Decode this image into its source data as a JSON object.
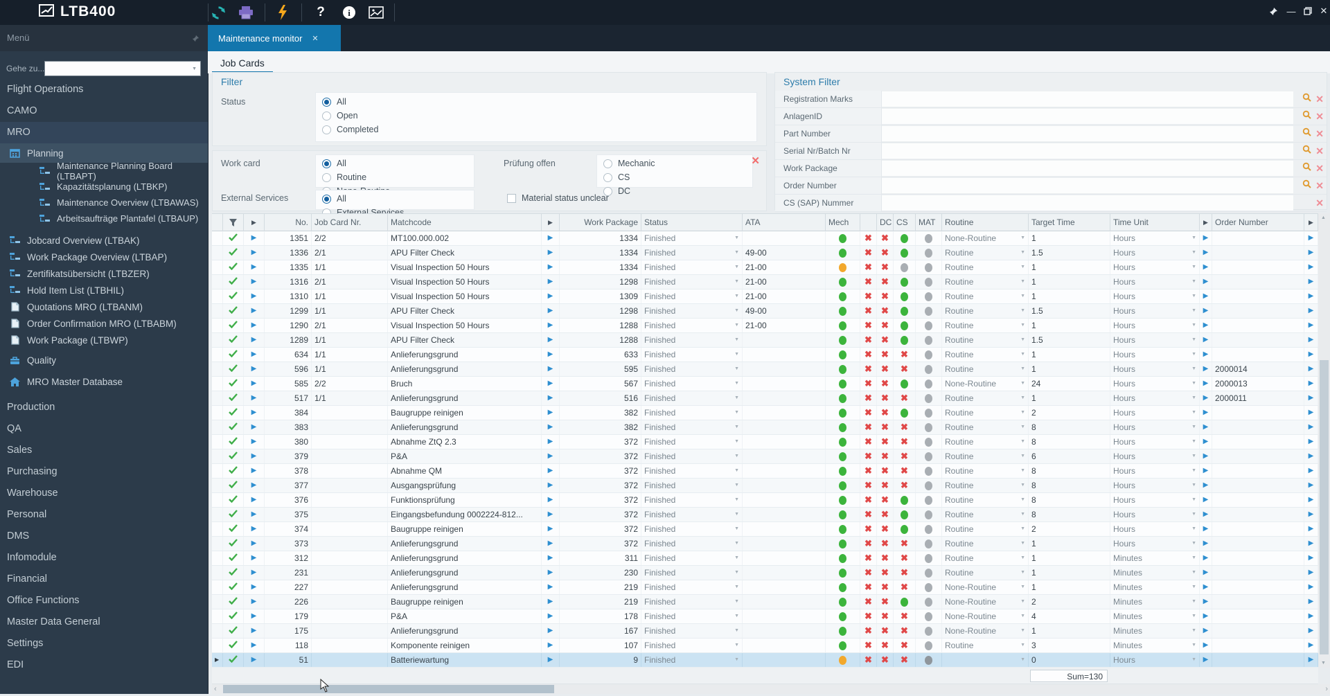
{
  "colors": {
    "accent": "#1376ad",
    "green": "#3cb43c",
    "orange": "#f2a82c",
    "red": "#e04848",
    "play_blue": "#2e8fd0",
    "teal": "#27b3b3",
    "purple": "#7d6bc4",
    "bolt_orange": "#f6a81c"
  },
  "topbar": {
    "logo": "LTB400",
    "icons": [
      "refresh-icon",
      "print-icon",
      "lightning-icon",
      "help-icon",
      "info-icon",
      "image-icon"
    ],
    "window_controls": [
      "pin-icon",
      "minimize-icon",
      "restore-icon",
      "close-icon"
    ]
  },
  "tabbar": {
    "menu_title": "Menü",
    "active_tab": "Maintenance monitor",
    "close_glyph": "✕"
  },
  "sidebar": {
    "goto_label": "Gehe zu...",
    "items": [
      {
        "label": "Flight Operations",
        "type": "section"
      },
      {
        "label": "CAMO",
        "type": "section"
      },
      {
        "label": "MRO",
        "type": "section",
        "state": "active"
      },
      {
        "label": "Planning",
        "icon": "calendar-icon",
        "indent": 1,
        "state": "selected"
      },
      {
        "label": "Maintenance Planning Board (LTBAPT)",
        "icon": "hierarchy-icon",
        "indent": 2
      },
      {
        "label": "Kapazitätsplanung (LTBKP)",
        "icon": "hierarchy-icon",
        "indent": 2
      },
      {
        "label": "Maintenance Overview (LTBAWAS)",
        "icon": "hierarchy-icon",
        "indent": 2
      },
      {
        "label": "Arbeitsaufträge Plantafel (LTBAUP)",
        "icon": "hierarchy-icon",
        "indent": 2
      },
      {
        "label": "Jobcard Overview (LTBAK)",
        "icon": "hierarchy-icon",
        "indent": 1,
        "gap": 8
      },
      {
        "label": "Work Package Overview (LTBAP)",
        "icon": "hierarchy-icon",
        "indent": 1
      },
      {
        "label": "Zertifikatsübersicht (LTBZER)",
        "icon": "hierarchy-icon",
        "indent": 1
      },
      {
        "label": "Hold Item List (LTBHIL)",
        "icon": "hierarchy-icon",
        "indent": 1
      },
      {
        "label": "Quotations MRO (LTBANM)",
        "icon": "document-icon",
        "indent": 1
      },
      {
        "label": "Order Confirmation MRO (LTBABM)",
        "icon": "document-icon",
        "indent": 1
      },
      {
        "label": "Work Package (LTBWP)",
        "icon": "document-icon",
        "indent": 1
      },
      {
        "label": "Quality",
        "icon": "briefcase-icon",
        "indent": 1,
        "gap": 5
      },
      {
        "label": "MRO Master Database",
        "icon": "home-icon",
        "indent": 1,
        "gap": 7
      },
      {
        "label": "Production",
        "type": "section",
        "gap": 10
      },
      {
        "label": "QA",
        "type": "section"
      },
      {
        "label": "Sales",
        "type": "section"
      },
      {
        "label": "Purchasing",
        "type": "section"
      },
      {
        "label": "Warehouse",
        "type": "section"
      },
      {
        "label": "Personal",
        "type": "section"
      },
      {
        "label": "DMS",
        "type": "section"
      },
      {
        "label": "Infomodule",
        "type": "section"
      },
      {
        "label": "Financial",
        "type": "section"
      },
      {
        "label": "Office Functions",
        "type": "section"
      },
      {
        "label": "Master Data General",
        "type": "section"
      },
      {
        "label": "Settings",
        "type": "section"
      },
      {
        "label": "EDI",
        "type": "section"
      }
    ]
  },
  "subtab": "Job Cards",
  "filter": {
    "title": "Filter",
    "status_label": "Status",
    "status_options": [
      "All",
      "Open",
      "Completed"
    ],
    "status_selected": 0,
    "workcard_label": "Work card",
    "workcard_options": [
      "All",
      "Routine",
      "None-Routine"
    ],
    "workcard_selected": 0,
    "extserv_label": "External Services",
    "extserv_options": [
      "All",
      "External Services"
    ],
    "extserv_selected": 0,
    "pruefung_label": "Prüfung offen",
    "pruefung_options": [
      "Mechanic",
      "CS",
      "DC"
    ],
    "pruefung_selected": -1,
    "material_label": "Material status unclear",
    "material_checked": false
  },
  "system_filter": {
    "title": "System Filter",
    "rows": [
      {
        "label": "Registration Marks",
        "has_search": true
      },
      {
        "label": "AnlagenID",
        "has_search": true
      },
      {
        "label": "Part Number",
        "has_search": true
      },
      {
        "label": "Serial Nr/Batch Nr",
        "has_search": true
      },
      {
        "label": "Work Package",
        "has_search": true
      },
      {
        "label": "Order Number",
        "has_search": true
      },
      {
        "label": "CS (SAP) Nummer",
        "has_search": false
      }
    ]
  },
  "table": {
    "headers": {
      "no": "No.",
      "jc": "Job Card Nr.",
      "match": "Matchcode",
      "wp": "Work Package",
      "status": "Status",
      "ata": "ATA",
      "mech": "Mech",
      "x1": "",
      "dc": "DC",
      "cs": "CS",
      "mat": "MAT",
      "routine": "Routine",
      "target": "Target Time",
      "unit": "Time Unit",
      "order": "Order Number"
    },
    "sum_label": "Sum=130",
    "rows": [
      {
        "no": "1351",
        "jc": "2/2",
        "match": "MT100.000.002",
        "wp": "1334",
        "status": "Finished",
        "ata": "",
        "mech": "green",
        "x1": "x",
        "dc": "x",
        "cs": "green",
        "mat": "gray",
        "routine": "None-Routine",
        "target": "1",
        "unit": "Hours",
        "order": "",
        "selected": false
      },
      {
        "no": "1336",
        "jc": "2/1",
        "match": "APU Filter Check",
        "wp": "1334",
        "status": "Finished",
        "ata": "49-00",
        "mech": "green",
        "x1": "x",
        "dc": "x",
        "cs": "green",
        "mat": "gray",
        "routine": "Routine",
        "target": "1.5",
        "unit": "Hours",
        "order": "",
        "selected": false
      },
      {
        "no": "1335",
        "jc": "1/1",
        "match": "Visual Inspection 50 Hours",
        "wp": "1334",
        "status": "Finished",
        "ata": "21-00",
        "mech": "orange",
        "x1": "x",
        "dc": "x",
        "cs": "gray",
        "mat": "gray",
        "routine": "Routine",
        "target": "1",
        "unit": "Hours",
        "order": "",
        "selected": false
      },
      {
        "no": "1316",
        "jc": "2/1",
        "match": "Visual Inspection 50 Hours",
        "wp": "1298",
        "status": "Finished",
        "ata": "21-00",
        "mech": "green",
        "x1": "x",
        "dc": "x",
        "cs": "green",
        "mat": "gray",
        "routine": "Routine",
        "target": "1",
        "unit": "Hours",
        "order": "",
        "selected": false
      },
      {
        "no": "1310",
        "jc": "1/1",
        "match": "Visual Inspection 50 Hours",
        "wp": "1309",
        "status": "Finished",
        "ata": "21-00",
        "mech": "green",
        "x1": "x",
        "dc": "x",
        "cs": "green",
        "mat": "gray",
        "routine": "Routine",
        "target": "1",
        "unit": "Hours",
        "order": "",
        "selected": false
      },
      {
        "no": "1299",
        "jc": "1/1",
        "match": "APU Filter Check",
        "wp": "1298",
        "status": "Finished",
        "ata": "49-00",
        "mech": "green",
        "x1": "x",
        "dc": "x",
        "cs": "green",
        "mat": "gray",
        "routine": "Routine",
        "target": "1.5",
        "unit": "Hours",
        "order": "",
        "selected": false
      },
      {
        "no": "1290",
        "jc": "2/1",
        "match": "Visual Inspection 50 Hours",
        "wp": "1288",
        "status": "Finished",
        "ata": "21-00",
        "mech": "green",
        "x1": "x",
        "dc": "x",
        "cs": "green",
        "mat": "gray",
        "routine": "Routine",
        "target": "1",
        "unit": "Hours",
        "order": "",
        "selected": false
      },
      {
        "no": "1289",
        "jc": "1/1",
        "match": "APU Filter Check",
        "wp": "1288",
        "status": "Finished",
        "ata": "",
        "mech": "green",
        "x1": "x",
        "dc": "x",
        "cs": "green",
        "mat": "gray",
        "routine": "Routine",
        "target": "1.5",
        "unit": "Hours",
        "order": "",
        "selected": false
      },
      {
        "no": "634",
        "jc": "1/1",
        "match": "Anlieferungsgrund",
        "wp": "633",
        "status": "Finished",
        "ata": "",
        "mech": "green",
        "x1": "x",
        "dc": "x",
        "cs": "x",
        "mat": "gray",
        "routine": "Routine",
        "target": "1",
        "unit": "Hours",
        "order": "",
        "selected": false
      },
      {
        "no": "596",
        "jc": "1/1",
        "match": "Anlieferungsgrund",
        "wp": "595",
        "status": "Finished",
        "ata": "",
        "mech": "green",
        "x1": "x",
        "dc": "x",
        "cs": "x",
        "mat": "gray",
        "routine": "Routine",
        "target": "1",
        "unit": "Hours",
        "order": "2000014",
        "selected": false
      },
      {
        "no": "585",
        "jc": "2/2",
        "match": "Bruch",
        "wp": "567",
        "status": "Finished",
        "ata": "",
        "mech": "green",
        "x1": "x",
        "dc": "x",
        "cs": "green",
        "mat": "gray",
        "routine": "None-Routine",
        "target": "24",
        "unit": "Hours",
        "order": "2000013",
        "selected": false
      },
      {
        "no": "517",
        "jc": "1/1",
        "match": "Anlieferungsgrund",
        "wp": "516",
        "status": "Finished",
        "ata": "",
        "mech": "green",
        "x1": "x",
        "dc": "x",
        "cs": "x",
        "mat": "gray",
        "routine": "Routine",
        "target": "1",
        "unit": "Hours",
        "order": "2000011",
        "selected": false
      },
      {
        "no": "384",
        "jc": "",
        "match": "Baugruppe reinigen",
        "wp": "382",
        "status": "Finished",
        "ata": "",
        "mech": "green",
        "x1": "x",
        "dc": "x",
        "cs": "green",
        "mat": "gray",
        "routine": "Routine",
        "target": "2",
        "unit": "Hours",
        "order": "",
        "selected": false
      },
      {
        "no": "383",
        "jc": "",
        "match": "Anlieferungsgrund",
        "wp": "382",
        "status": "Finished",
        "ata": "",
        "mech": "green",
        "x1": "x",
        "dc": "x",
        "cs": "x",
        "mat": "gray",
        "routine": "Routine",
        "target": "8",
        "unit": "Hours",
        "order": "",
        "selected": false
      },
      {
        "no": "380",
        "jc": "",
        "match": "Abnahme ZtQ 2.3",
        "wp": "372",
        "status": "Finished",
        "ata": "",
        "mech": "green",
        "x1": "x",
        "dc": "x",
        "cs": "x",
        "mat": "gray",
        "routine": "Routine",
        "target": "8",
        "unit": "Hours",
        "order": "",
        "selected": false
      },
      {
        "no": "379",
        "jc": "",
        "match": "P&A",
        "wp": "372",
        "status": "Finished",
        "ata": "",
        "mech": "green",
        "x1": "x",
        "dc": "x",
        "cs": "x",
        "mat": "gray",
        "routine": "Routine",
        "target": "6",
        "unit": "Hours",
        "order": "",
        "selected": false
      },
      {
        "no": "378",
        "jc": "",
        "match": "Abnahme QM",
        "wp": "372",
        "status": "Finished",
        "ata": "",
        "mech": "green",
        "x1": "x",
        "dc": "x",
        "cs": "x",
        "mat": "gray",
        "routine": "Routine",
        "target": "8",
        "unit": "Hours",
        "order": "",
        "selected": false
      },
      {
        "no": "377",
        "jc": "",
        "match": "Ausgangsprüfung",
        "wp": "372",
        "status": "Finished",
        "ata": "",
        "mech": "green",
        "x1": "x",
        "dc": "x",
        "cs": "x",
        "mat": "gray",
        "routine": "Routine",
        "target": "8",
        "unit": "Hours",
        "order": "",
        "selected": false
      },
      {
        "no": "376",
        "jc": "",
        "match": "Funktionsprüfung",
        "wp": "372",
        "status": "Finished",
        "ata": "",
        "mech": "green",
        "x1": "x",
        "dc": "x",
        "cs": "green",
        "mat": "gray",
        "routine": "Routine",
        "target": "8",
        "unit": "Hours",
        "order": "",
        "selected": false
      },
      {
        "no": "375",
        "jc": "",
        "match": "Eingangsbefundung 0002224-812...",
        "wp": "372",
        "status": "Finished",
        "ata": "",
        "mech": "green",
        "x1": "x",
        "dc": "x",
        "cs": "green",
        "mat": "gray",
        "routine": "Routine",
        "target": "8",
        "unit": "Hours",
        "order": "",
        "selected": false
      },
      {
        "no": "374",
        "jc": "",
        "match": "Baugruppe reinigen",
        "wp": "372",
        "status": "Finished",
        "ata": "",
        "mech": "green",
        "x1": "x",
        "dc": "x",
        "cs": "green",
        "mat": "gray",
        "routine": "Routine",
        "target": "2",
        "unit": "Hours",
        "order": "",
        "selected": false
      },
      {
        "no": "373",
        "jc": "",
        "match": "Anlieferungsgrund",
        "wp": "372",
        "status": "Finished",
        "ata": "",
        "mech": "green",
        "x1": "x",
        "dc": "x",
        "cs": "x",
        "mat": "gray",
        "routine": "Routine",
        "target": "1",
        "unit": "Hours",
        "order": "",
        "selected": false
      },
      {
        "no": "312",
        "jc": "",
        "match": "Anlieferungsgrund",
        "wp": "311",
        "status": "Finished",
        "ata": "",
        "mech": "green",
        "x1": "x",
        "dc": "x",
        "cs": "x",
        "mat": "gray",
        "routine": "Routine",
        "target": "1",
        "unit": "Minutes",
        "order": "",
        "selected": false
      },
      {
        "no": "231",
        "jc": "",
        "match": "Anlieferungsgrund",
        "wp": "230",
        "status": "Finished",
        "ata": "",
        "mech": "green",
        "x1": "x",
        "dc": "x",
        "cs": "x",
        "mat": "gray",
        "routine": "Routine",
        "target": "1",
        "unit": "Minutes",
        "order": "",
        "selected": false
      },
      {
        "no": "227",
        "jc": "",
        "match": "Anlieferungsgrund",
        "wp": "219",
        "status": "Finished",
        "ata": "",
        "mech": "green",
        "x1": "x",
        "dc": "x",
        "cs": "x",
        "mat": "gray",
        "routine": "None-Routine",
        "target": "1",
        "unit": "Minutes",
        "order": "",
        "selected": false
      },
      {
        "no": "226",
        "jc": "",
        "match": "Baugruppe reinigen",
        "wp": "219",
        "status": "Finished",
        "ata": "",
        "mech": "green",
        "x1": "x",
        "dc": "x",
        "cs": "green",
        "mat": "gray",
        "routine": "None-Routine",
        "target": "2",
        "unit": "Minutes",
        "order": "",
        "selected": false
      },
      {
        "no": "179",
        "jc": "",
        "match": "P&A",
        "wp": "178",
        "status": "Finished",
        "ata": "",
        "mech": "green",
        "x1": "x",
        "dc": "x",
        "cs": "x",
        "mat": "gray",
        "routine": "None-Routine",
        "target": "4",
        "unit": "Minutes",
        "order": "",
        "selected": false
      },
      {
        "no": "175",
        "jc": "",
        "match": "Anlieferungsgrund",
        "wp": "167",
        "status": "Finished",
        "ata": "",
        "mech": "green",
        "x1": "x",
        "dc": "x",
        "cs": "x",
        "mat": "gray",
        "routine": "None-Routine",
        "target": "1",
        "unit": "Minutes",
        "order": "",
        "selected": false
      },
      {
        "no": "118",
        "jc": "",
        "match": "Komponente reinigen",
        "wp": "107",
        "status": "Finished",
        "ata": "",
        "mech": "green",
        "x1": "x",
        "dc": "x",
        "cs": "x",
        "mat": "gray",
        "routine": "Routine",
        "target": "3",
        "unit": "Minutes",
        "order": "",
        "selected": false
      },
      {
        "no": "51",
        "jc": "",
        "match": "Batteriewartung",
        "wp": "9",
        "status": "Finished",
        "ata": "",
        "mech": "orange",
        "x1": "x",
        "dc": "x",
        "cs": "x",
        "mat": "gray2",
        "routine": "",
        "target": "0",
        "unit": "Hours",
        "order": "",
        "selected": true
      }
    ]
  }
}
